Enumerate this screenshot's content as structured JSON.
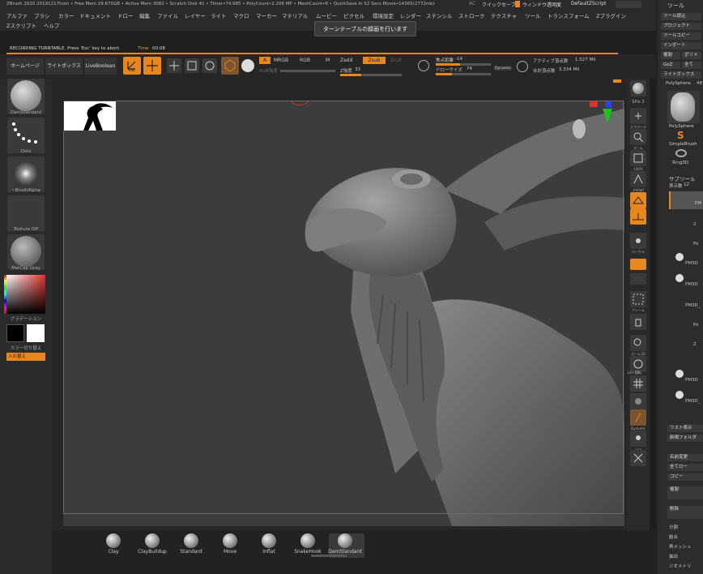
{
  "titlebar": {
    "title": "ZBrush 2020 20191217hom  • Free Mem 29.675GB • Active Mem 3082 • Scratch Disk 41 • Timer•74.985 • PolyCount•2.206 MP • MeshCount•6 • QuickSave In 52 Secs Movie•14365(2772mb)",
    "ac": "AC",
    "quicksave": "クイックセーブ",
    "window_transparent": "ウィンドウ透明度",
    "script": "DefaultZScript"
  },
  "menu": {
    "row1": [
      "アルファ",
      "ブラシ",
      "カラー",
      "ドキュメント",
      "ドロー",
      "編集",
      "ファイル",
      "レイヤー",
      "ライト",
      "マクロ",
      "マーカー",
      "マテリアル",
      "ムービー",
      "ピクセル",
      "環境設定",
      "レンダー",
      "ステンシル",
      "ストローク",
      "テクスチャ",
      "ツール",
      "トランスフォーム",
      "Zプラグイン"
    ],
    "row2": [
      "Zスクリプト",
      "ヘルプ"
    ]
  },
  "tooltip": "ターンテーブルの録画を行います",
  "recording": {
    "text": "RECORDING TURNTABLE. Press 'Esc' key to abort.",
    "time_label": "Time",
    "time_value": "00:08"
  },
  "toolbar": {
    "home": "ホームページ",
    "lightbox": "ライトボックス",
    "liveboolean": "LiveBoolean",
    "edit": "Edit",
    "draw": "ドロー",
    "move": "移動",
    "scale": "スケール",
    "rotate": "回転",
    "a_btn": "A",
    "mrgb": "MRGB",
    "rgb": "RGB",
    "m": "M",
    "zadd": "Zadd",
    "zsub": "Zsub",
    "zcut": "Zcut",
    "rgb_strength": "RGB強度",
    "z_strength_label": "Z強度",
    "z_strength_value": "33",
    "focal_shift_label": "焦点距離",
    "focal_shift_value": "-14",
    "draw_size_label": "ドローサイズ",
    "draw_size_value": "74",
    "dynamic": "Dynamic",
    "active_points_label": "アクティブ頂点数",
    "active_points_value": "1.527 Mil",
    "total_points_label": "合計頂点数",
    "total_points_value": "3.334 Mil"
  },
  "leftshelf": {
    "brush_label": "DamStandard",
    "stroke_label": "Dots",
    "alpha_label": "~BrushAlpha",
    "texture_label": "Texture Off",
    "material_label": "MatCap Gray",
    "gradient_label": "グラデーション",
    "swap_label": "カラー切り替え",
    "swap_button": "入れ替え"
  },
  "rightshelf": {
    "spix_label": "SPix",
    "spix_value": "3",
    "buttons": [
      "スクロール",
      "ズーム",
      "100%",
      "AAHalf",
      "パース",
      "フロア",
      "ローカル",
      "シンメトリ",
      "フレーム",
      "移動",
      "ズーム3D",
      "回転",
      "Line Fill",
      "透明",
      "Dynamic",
      "ソロ"
    ]
  },
  "tray": {
    "header": "ツール",
    "buttons": [
      "ツール読込",
      "プロジェクト",
      "ツールコピー",
      "インポート",
      "複製",
      "ポリメ",
      "GoZ",
      "全て",
      "ライトボックス"
    ],
    "polysphere_label": "PolySphere.",
    "polysphere_count": "48",
    "tool_items": [
      "PolySphere",
      "SimpleBrush",
      "Ring3D"
    ],
    "subtool_header": "サブツール",
    "visible_count_label": "表示数",
    "visible_count_value": "12",
    "subtool_names": [
      "PM",
      "2",
      "Po",
      "PM3D",
      "PM3D",
      "PM3D_",
      "Po",
      "Z",
      "PM3D",
      "PM3D_"
    ],
    "list_all": "リスト表示",
    "new_folder": "新規フォルダ",
    "rename": "名前変更",
    "all_low": "全てロー",
    "copy": "コピー",
    "duplicate": "複製",
    "delete": "削除",
    "split": "分割",
    "merge": "結合",
    "remesh": "再メッシュ",
    "extract": "抽出",
    "project": "投影",
    "geometry": "ジオメトリ"
  },
  "bottom_brushes": [
    "Clay",
    "ClayBuildup",
    "Standard",
    "Move",
    "Inflat",
    "SnakeHook",
    "DamStandard"
  ]
}
